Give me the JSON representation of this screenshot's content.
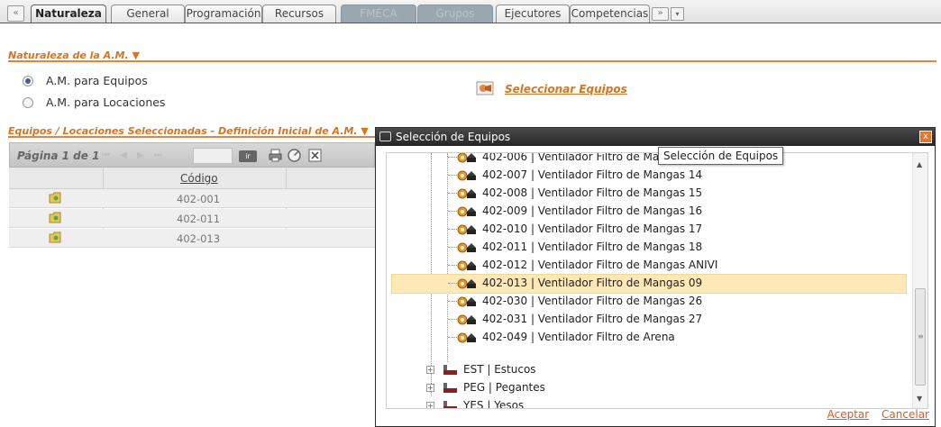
{
  "tabs": {
    "prev_label": "«",
    "items": [
      {
        "label": "Naturaleza"
      },
      {
        "label": "General"
      },
      {
        "label": "Programación"
      },
      {
        "label": "Recursos"
      },
      {
        "label": "FMECA"
      },
      {
        "label": "Grupos"
      },
      {
        "label": "Ejecutores"
      },
      {
        "label": "Competencias"
      }
    ],
    "more_label": "»",
    "menu_label": "▾"
  },
  "naturaleza": {
    "header": "Naturaleza de la A.M. ▼",
    "options": [
      "A.M. para Equipos",
      "A.M. para Locaciones"
    ],
    "selected": "A.M. para Equipos",
    "select_link": "Seleccionar Equipos"
  },
  "equipos": {
    "header": "Equipos / Locaciones Seleccionadas - Definición Inicial de A.M. ▼",
    "pager_label": "Página 1 de 1",
    "pager_buttons": "⏮ ◀ ▶ ⏭",
    "go_label": "ir",
    "column_code": "Código",
    "rows": [
      "402-001",
      "402-011",
      "402-013"
    ]
  },
  "modal": {
    "title": "Selección de Equipos",
    "close_label": "x",
    "partial_top": "402-006 | Ventilador Filtro de Mangas",
    "items": [
      "402-007 | Ventilador Filtro de Mangas 14",
      "402-008 | Ventilador Filtro de Mangas 15",
      "402-009 | Ventilador Filtro de Mangas 16",
      "402-010 | Ventilador Filtro de Mangas 17",
      "402-011 | Ventilador Filtro de Mangas 18",
      "402-012 | Ventilador Filtro de Mangas ANIVI",
      "402-013 | Ventilador Filtro de Mangas 09",
      "402-030 | Ventilador Filtro de Mangas 26",
      "402-031 | Ventilador Filtro de Mangas 27",
      "402-049 | Ventilador Filtro de Arena"
    ],
    "selected_item": "402-013 | Ventilador Filtro de Mangas 09",
    "groups": [
      "EST | Estucos",
      "PEG | Pegantes",
      "YES | Yesos"
    ],
    "accept_label": "Aceptar",
    "cancel_label": "Cancelar",
    "tooltip": "Selección de Equipos"
  },
  "colors": {
    "accent_orange": "#d9731f",
    "selection": "#fde9b8",
    "modal_title_bg": "#2e2e2e"
  }
}
